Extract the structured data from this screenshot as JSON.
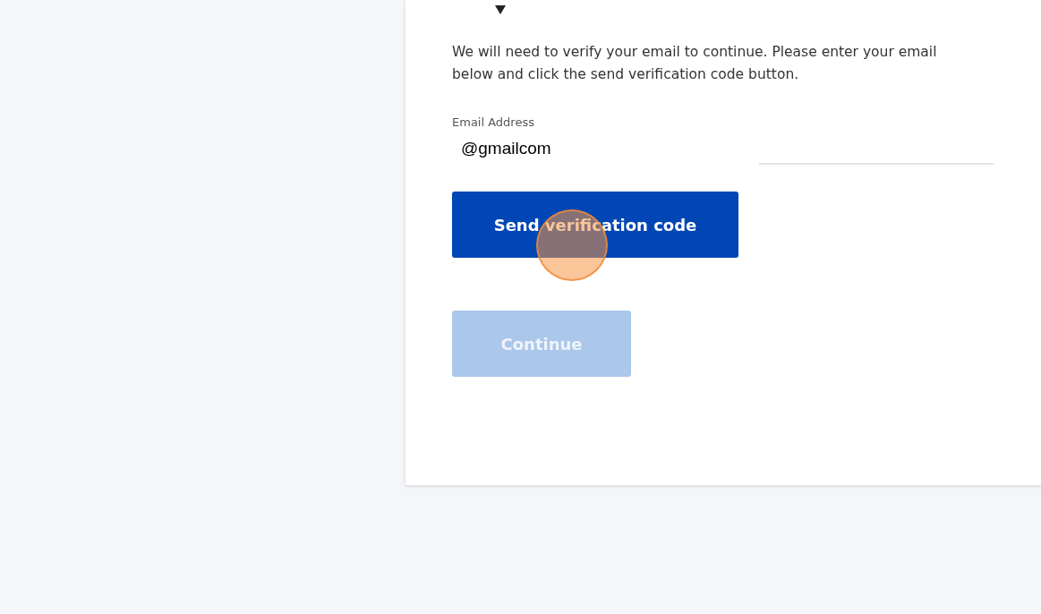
{
  "intro": "We will need to verify your email to continue. Please enter your email below and click the send verification code button.",
  "email": {
    "label": "Email Address",
    "value": "@gmailcom"
  },
  "buttons": [
    {
      "label": "Send verification code",
      "disabled": false,
      "clicked": true
    },
    {
      "label": "Continue",
      "disabled": true,
      "clicked": false
    }
  ]
}
